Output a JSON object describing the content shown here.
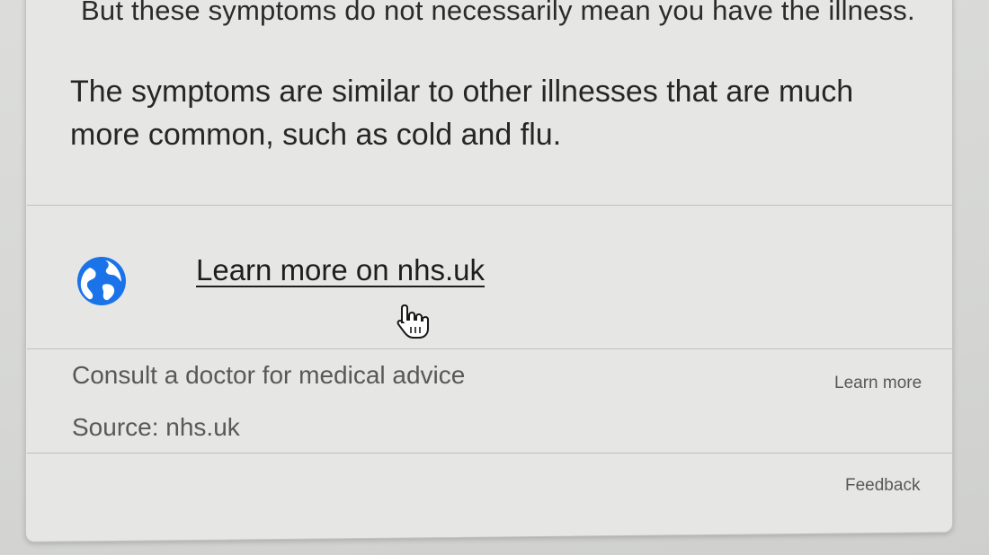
{
  "panel": {
    "partial_line": "But these symptoms do not necessarily mean you have the illness.",
    "paragraph": "The symptoms are similar to other illnesses that are much more common, such as cold and flu.",
    "link_label": "Learn more on nhs.uk",
    "link_icon": "globe-icon",
    "disclaimer": "Consult a doctor for medical advice",
    "source": "Source: nhs.uk",
    "learn_more_label": "Learn more",
    "feedback_label": "Feedback"
  },
  "colors": {
    "globe": "#1a73e8",
    "text": "#262626",
    "muted": "#585858"
  },
  "cursor": "hand-pointer-icon"
}
